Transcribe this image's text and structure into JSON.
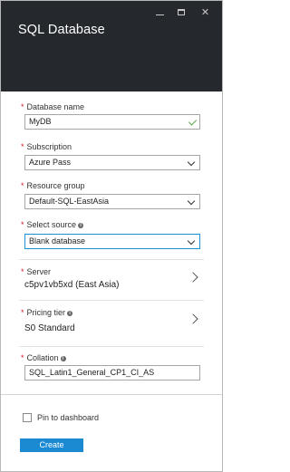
{
  "header": {
    "title": "SQL Database"
  },
  "fields": {
    "database_name": {
      "label": "Database name",
      "value": "MyDB",
      "required": true
    },
    "subscription": {
      "label": "Subscription",
      "value": "Azure Pass",
      "required": true
    },
    "resource_group": {
      "label": "Resource group",
      "value": "Default-SQL-EastAsia",
      "required": true
    },
    "select_source": {
      "label": "Select source",
      "value": "Blank database",
      "required": true
    },
    "server": {
      "label": "Server",
      "value": "c5pv1vb5xd (East Asia)",
      "required": true
    },
    "pricing_tier": {
      "label": "Pricing tier",
      "value": "S0 Standard",
      "required": true
    },
    "collation": {
      "label": "Collation",
      "value": "SQL_Latin1_General_CP1_CI_AS",
      "required": true
    }
  },
  "required_marker": "*",
  "pin": {
    "label": "Pin to dashboard",
    "checked": false
  },
  "create": {
    "label": "Create"
  },
  "colors": {
    "header_bg": "#25292e",
    "required": "#d3212d",
    "accent": "#1b8ad3",
    "valid_check": "#5ba84a"
  },
  "icons": {
    "minimize": "minimize-icon",
    "maximize": "maximize-icon",
    "close": "close-icon",
    "info": "info-icon",
    "chevron_down": "chevron-down-icon",
    "chevron_right": "chevron-right-icon",
    "checkmark": "checkmark-icon"
  }
}
